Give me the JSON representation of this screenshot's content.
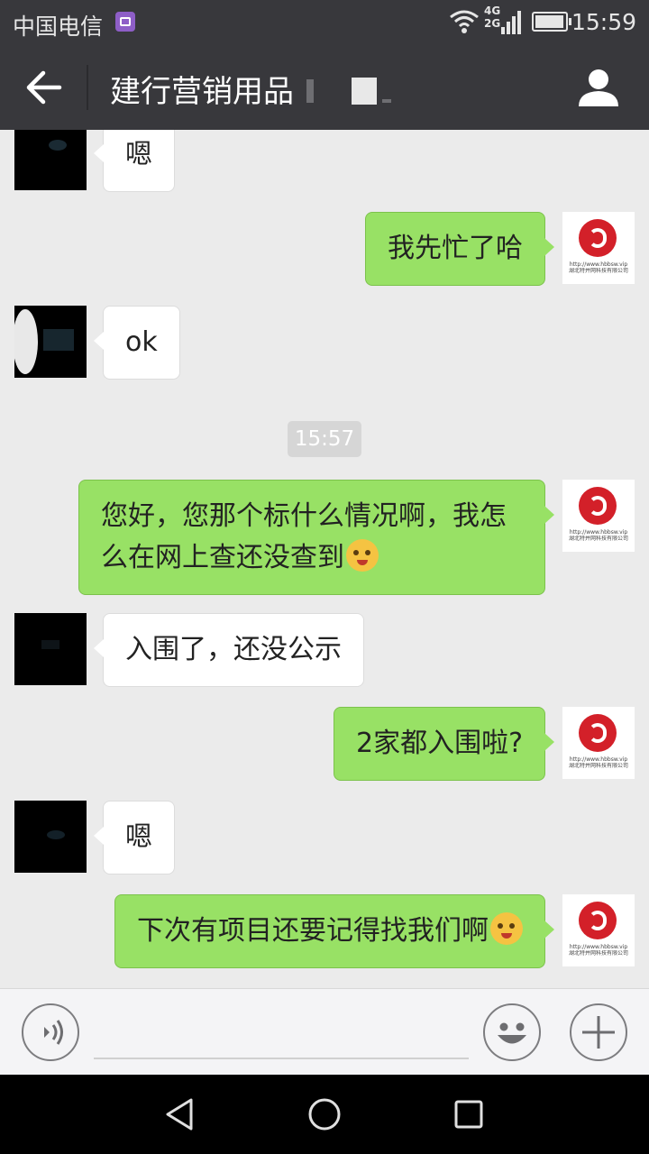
{
  "status_bar": {
    "carrier": "中国电信",
    "network_top": "4G",
    "network_bottom": "2G",
    "time": "15:59"
  },
  "header": {
    "title": "建行营销用品"
  },
  "messages": [
    {
      "side": "left",
      "text": "嗯"
    },
    {
      "side": "right",
      "text": "我先忙了哈"
    },
    {
      "side": "left",
      "text": "ok"
    },
    {
      "side": "right",
      "text_line1": "您好，您那个标什么情况啊，我怎",
      "text_line2": "么在网上查还没查到",
      "emoji": "worried-face-icon"
    },
    {
      "side": "left",
      "text": "入围了，还没公示"
    },
    {
      "side": "right",
      "text": "2家都入围啦?"
    },
    {
      "side": "left",
      "text": "嗯"
    },
    {
      "side": "right",
      "text": "下次有项目还要记得找我们啊",
      "emoji": "winking-tongue-face-icon"
    }
  ],
  "timestamp": "15:57",
  "avatar_right": {
    "url_text": "http://www.hbbsw.vip",
    "company_text": "湖北特并网科技有限公司"
  },
  "colors": {
    "header_bg": "#38383c",
    "chat_bg": "#ebebeb",
    "bubble_sent": "#98e165",
    "bubble_received": "#ffffff",
    "logo_red": "#d32029"
  }
}
